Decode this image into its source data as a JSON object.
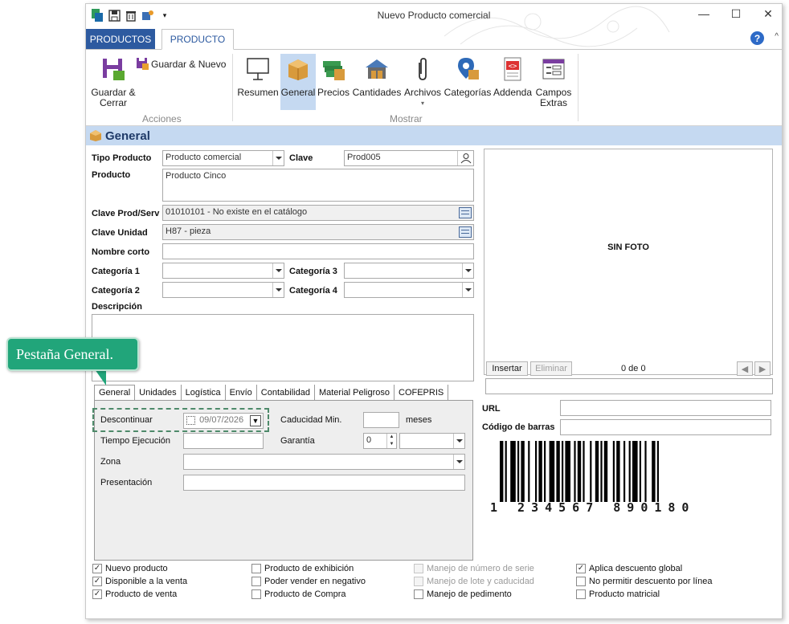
{
  "window": {
    "title": "Nuevo Producto comercial",
    "controls": [
      "—",
      "☐",
      "✕"
    ]
  },
  "ribbon_tabs": {
    "productos": "PRODUCTOS",
    "producto": "PRODUCTO"
  },
  "ribbon": {
    "guardar_cerrar": "Guardar & Cerrar",
    "guardar_nuevo": "Guardar & Nuevo",
    "acciones_group": "Acciones",
    "mostrar_group": "Mostrar",
    "buttons": [
      {
        "label": "Resumen"
      },
      {
        "label": "General"
      },
      {
        "label": "Precios"
      },
      {
        "label": "Cantidades"
      },
      {
        "label": "Archivos"
      },
      {
        "label": "Categorías"
      },
      {
        "label": "Addenda"
      },
      {
        "label": "Campos Extras"
      }
    ]
  },
  "section": {
    "title": "General"
  },
  "form": {
    "tipo_producto_label": "Tipo Producto",
    "tipo_producto_value": "Producto comercial",
    "clave_label": "Clave",
    "clave_value": "Prod005",
    "producto_label": "Producto",
    "producto_value": "Producto Cinco",
    "clave_prodserv_label": "Clave Prod/Serv",
    "clave_prodserv_value": "01010101 - No existe en el catálogo",
    "clave_unidad_label": "Clave Unidad",
    "clave_unidad_value": "H87 - pieza",
    "nombre_corto_label": "Nombre corto",
    "nombre_corto_value": "",
    "categoria1_label": "Categoría 1",
    "categoria2_label": "Categoría 2",
    "categoria3_label": "Categoría 3",
    "categoria4_label": "Categoría 4",
    "descripcion_label": "Descripción"
  },
  "photo": {
    "placeholder": "SIN FOTO",
    "insertar": "Insertar",
    "eliminar": "Eliminar",
    "counter": "0 de 0",
    "url_label": "URL",
    "barcode_label": "Código de barras",
    "barcode_digits": "1 234567 890180"
  },
  "subtabs": [
    "General",
    "Unidades",
    "Logística",
    "Envío",
    "Contabilidad",
    "Material Peligroso",
    "COFEPRIS"
  ],
  "general_tab": {
    "descontinuar_label": "Descontinuar",
    "descontinuar_date": "09/07/2026",
    "caducidad_label": "Caducidad Min.",
    "caducidad_unit": "meses",
    "tiempo_label": "Tiempo Ejecución",
    "garantia_label": "Garantía",
    "garantia_value": "0",
    "zona_label": "Zona",
    "presentacion_label": "Presentación"
  },
  "callout": {
    "text": "Pestaña General."
  },
  "checkboxes": [
    {
      "label": "Nuevo producto",
      "checked": true,
      "disabled": false
    },
    {
      "label": "Disponible a la venta",
      "checked": true,
      "disabled": false
    },
    {
      "label": "Producto de venta",
      "checked": true,
      "disabled": false
    },
    {
      "label": "Producto de exhibición",
      "checked": false,
      "disabled": false
    },
    {
      "label": "Poder vender en negativo",
      "checked": false,
      "disabled": false
    },
    {
      "label": "Producto de Compra",
      "checked": false,
      "disabled": false
    },
    {
      "label": "Manejo de número de serie",
      "checked": false,
      "disabled": true
    },
    {
      "label": "Manejo de lote y caducidad",
      "checked": false,
      "disabled": true
    },
    {
      "label": "Manejo de pedimento",
      "checked": false,
      "disabled": false
    },
    {
      "label": "Aplica descuento global",
      "checked": true,
      "disabled": false
    },
    {
      "label": "No permitir descuento por línea",
      "checked": false,
      "disabled": false
    },
    {
      "label": "Producto matricial",
      "checked": false,
      "disabled": false
    }
  ],
  "colors": {
    "accent": "#2d5aa0",
    "section_band": "#c5d9f1",
    "callout": "#21a57a"
  }
}
